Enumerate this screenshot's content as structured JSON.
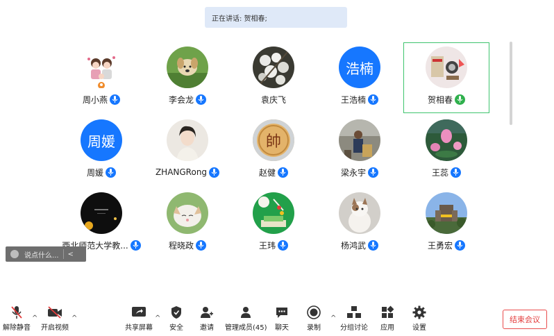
{
  "banner": {
    "speaking_text": "正在讲话: 贺相春;"
  },
  "participants": [
    {
      "name": "周小燕"
    },
    {
      "name": "李会龙"
    },
    {
      "name": "袁庆飞"
    },
    {
      "name": "王浩楠",
      "avatar_text": "浩楠"
    },
    {
      "name": "贺相春",
      "speaking": true
    },
    {
      "name": "周媛",
      "avatar_text": "周媛"
    },
    {
      "name": "ZHANGRong"
    },
    {
      "name": "赵健",
      "avatar_text": "帥"
    },
    {
      "name": "梁永宇"
    },
    {
      "name": "王蕊"
    },
    {
      "name": "西北师范大学教..."
    },
    {
      "name": "程晓政"
    },
    {
      "name": "王玮"
    },
    {
      "name": "杨鸿武"
    },
    {
      "name": "王勇宏"
    }
  ],
  "chat": {
    "placeholder": "说点什么...",
    "chevron": "<"
  },
  "toolbar": {
    "unmute": "解除静音",
    "start_video": "开启视频",
    "share_screen": "共享屏幕",
    "security": "安全",
    "invite": "邀请",
    "manage_members": "管理成员(45)",
    "chat": "聊天",
    "record": "录制",
    "breakout": "分组讨论",
    "apps": "应用",
    "settings": "设置",
    "end_meeting": "结束会议"
  },
  "colors": {
    "accent": "#1677ff",
    "speaking": "#2fb04d",
    "end": "#e33c3c"
  }
}
